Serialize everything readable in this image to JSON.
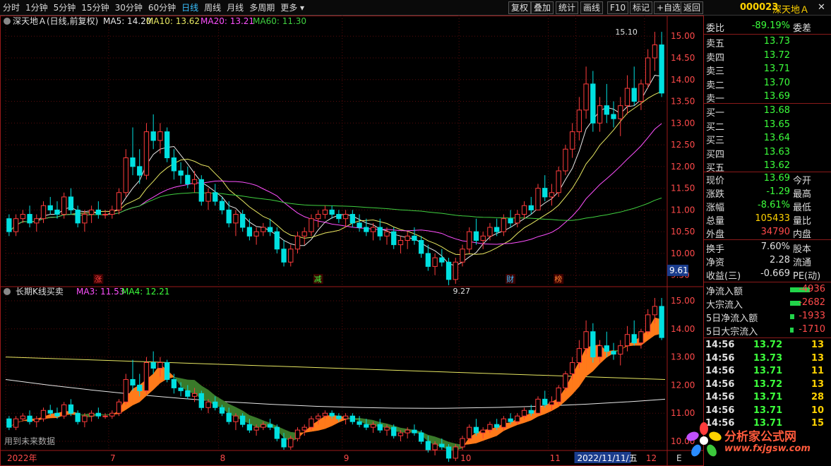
{
  "toolbar": {
    "timeframes": [
      "分时",
      "1分钟",
      "5分钟",
      "15分钟",
      "30分钟",
      "60分钟",
      "日线",
      "周线",
      "月线",
      "多周期",
      "更多"
    ],
    "active_timeframe": "日线",
    "right_buttons": [
      "复权",
      "叠加",
      "统计",
      "画线",
      "F10",
      "标记",
      "+自选",
      "返回"
    ],
    "stock_code": "000023",
    "stock_name": "深天地Ａ",
    "close_icon": "close-icon"
  },
  "main_chart": {
    "title": "深天地Ａ(日线,前复权)",
    "ma_labels": [
      {
        "text": "MA5: 14.20",
        "color": "#e8e8e8"
      },
      {
        "text": "MA10: 13.62",
        "color": "#e8e862"
      },
      {
        "text": "MA20: 13.21",
        "color": "#ff50ff"
      },
      {
        "text": "MA60: 11.30",
        "color": "#40d040"
      }
    ],
    "y_ticks": [
      "15.00",
      "14.50",
      "14.00",
      "13.50",
      "13.00",
      "12.50",
      "12.00",
      "11.50",
      "11.00",
      "10.50",
      "10.00",
      "9.50"
    ],
    "y_max": 15.15,
    "y_min": 9.3,
    "current_price_tag": "9.61",
    "high_marker": "15.10",
    "low_marker": "9.27",
    "event_markers": [
      {
        "text": "涨",
        "color": "#ff4040"
      },
      {
        "text": "减",
        "color": "#3cff3c"
      },
      {
        "text": "财",
        "color": "#39c0ff"
      },
      {
        "text": "榜",
        "color": "#ff8030"
      }
    ]
  },
  "sub_chart": {
    "title": "长期K线买卖",
    "ma_labels": [
      {
        "text": "MA3: 11.53",
        "color": "#ff50ff"
      },
      {
        "text": "MA4: 12.21",
        "color": "#3cff3c"
      }
    ],
    "y_ticks": [
      "15.00",
      "14.00",
      "13.00",
      "12.00",
      "11.00",
      "10.00"
    ],
    "y_max": 15.3,
    "y_min": 9.7,
    "footer_note": "用到未来数据"
  },
  "x_axis": {
    "labels": [
      "2022年",
      "7",
      "8",
      "9",
      "10",
      "11",
      "2022/11/11/五",
      "12"
    ],
    "right_label": "E"
  },
  "chart_data": {
    "type": "candlestick",
    "dates_approx": "2022-05 to 2022-12",
    "ohlc": [
      [
        10.8,
        10.9,
        10.4,
        10.5
      ],
      [
        10.5,
        10.9,
        10.4,
        10.8
      ],
      [
        10.8,
        11.0,
        10.7,
        10.9
      ],
      [
        10.9,
        11.1,
        10.6,
        10.7
      ],
      [
        10.7,
        10.9,
        10.5,
        10.8
      ],
      [
        10.8,
        11.2,
        10.7,
        11.1
      ],
      [
        11.1,
        11.3,
        10.9,
        11.0
      ],
      [
        11.0,
        11.2,
        10.8,
        10.9
      ],
      [
        10.9,
        11.4,
        10.8,
        11.3
      ],
      [
        11.3,
        11.5,
        10.9,
        11.0
      ],
      [
        11.0,
        11.1,
        10.6,
        10.7
      ],
      [
        10.7,
        11.0,
        10.5,
        10.9
      ],
      [
        10.9,
        11.1,
        10.7,
        11.0
      ],
      [
        11.0,
        11.2,
        10.8,
        10.9
      ],
      [
        10.9,
        11.0,
        10.8,
        10.9
      ],
      [
        10.9,
        11.1,
        10.8,
        11.0
      ],
      [
        11.0,
        11.5,
        10.9,
        11.4
      ],
      [
        11.4,
        12.4,
        11.3,
        12.2
      ],
      [
        12.2,
        12.9,
        11.8,
        12.0
      ],
      [
        12.0,
        12.4,
        11.6,
        11.8
      ],
      [
        11.8,
        13.0,
        11.7,
        12.8
      ],
      [
        12.8,
        13.2,
        12.4,
        12.6
      ],
      [
        12.6,
        13.0,
        12.3,
        12.8
      ],
      [
        12.8,
        12.9,
        12.1,
        12.2
      ],
      [
        12.2,
        12.4,
        11.7,
        11.9
      ],
      [
        11.9,
        12.1,
        11.6,
        11.8
      ],
      [
        11.8,
        12.0,
        11.5,
        11.6
      ],
      [
        11.6,
        11.9,
        11.4,
        11.7
      ],
      [
        11.7,
        11.8,
        11.1,
        11.2
      ],
      [
        11.2,
        11.5,
        11.0,
        11.4
      ],
      [
        11.4,
        11.6,
        11.1,
        11.2
      ],
      [
        11.2,
        11.3,
        10.9,
        11.0
      ],
      [
        11.0,
        11.2,
        10.6,
        10.7
      ],
      [
        10.7,
        11.0,
        10.4,
        10.9
      ],
      [
        10.9,
        11.0,
        10.5,
        10.6
      ],
      [
        10.6,
        10.8,
        10.3,
        10.4
      ],
      [
        10.4,
        10.6,
        10.2,
        10.5
      ],
      [
        10.5,
        10.7,
        10.4,
        10.6
      ],
      [
        10.6,
        10.8,
        10.4,
        10.5
      ],
      [
        10.5,
        10.6,
        10.0,
        10.1
      ],
      [
        10.1,
        10.3,
        9.7,
        9.8
      ],
      [
        9.8,
        10.2,
        9.7,
        10.1
      ],
      [
        10.1,
        10.5,
        10.0,
        10.4
      ],
      [
        10.4,
        10.6,
        10.2,
        10.5
      ],
      [
        10.5,
        10.9,
        10.4,
        10.8
      ],
      [
        10.8,
        11.0,
        10.6,
        10.9
      ],
      [
        10.9,
        11.1,
        10.8,
        11.0
      ],
      [
        11.0,
        11.1,
        10.8,
        10.9
      ],
      [
        10.9,
        11.0,
        10.7,
        10.8
      ],
      [
        10.8,
        11.0,
        10.6,
        10.9
      ],
      [
        10.9,
        11.0,
        10.6,
        10.7
      ],
      [
        10.7,
        10.9,
        10.5,
        10.6
      ],
      [
        10.6,
        10.8,
        10.4,
        10.5
      ],
      [
        10.5,
        10.7,
        10.3,
        10.6
      ],
      [
        10.6,
        10.8,
        10.3,
        10.4
      ],
      [
        10.4,
        10.6,
        10.2,
        10.5
      ],
      [
        10.5,
        10.6,
        10.1,
        10.2
      ],
      [
        10.2,
        10.4,
        10.0,
        10.3
      ],
      [
        10.3,
        10.5,
        10.1,
        10.4
      ],
      [
        10.4,
        10.6,
        10.2,
        10.3
      ],
      [
        10.3,
        10.4,
        9.9,
        10.0
      ],
      [
        10.0,
        10.2,
        9.6,
        9.7
      ],
      [
        9.7,
        10.0,
        9.5,
        9.9
      ],
      [
        9.9,
        10.1,
        9.7,
        9.8
      ],
      [
        9.8,
        9.9,
        9.27,
        9.4
      ],
      [
        9.4,
        9.9,
        9.3,
        9.8
      ],
      [
        9.8,
        10.2,
        9.7,
        10.1
      ],
      [
        10.1,
        10.6,
        10.0,
        10.5
      ],
      [
        10.5,
        10.8,
        10.2,
        10.3
      ],
      [
        10.3,
        10.5,
        10.1,
        10.4
      ],
      [
        10.4,
        10.7,
        10.3,
        10.6
      ],
      [
        10.6,
        10.8,
        10.4,
        10.5
      ],
      [
        10.5,
        10.9,
        10.4,
        10.8
      ],
      [
        10.8,
        11.0,
        10.6,
        10.7
      ],
      [
        10.7,
        11.0,
        10.6,
        10.9
      ],
      [
        10.9,
        11.2,
        10.8,
        11.1
      ],
      [
        11.1,
        11.3,
        10.9,
        11.0
      ],
      [
        11.0,
        11.6,
        11.0,
        11.5
      ],
      [
        11.5,
        11.8,
        11.2,
        11.3
      ],
      [
        11.3,
        11.6,
        11.1,
        11.4
      ],
      [
        11.4,
        12.0,
        11.3,
        11.9
      ],
      [
        11.9,
        12.5,
        11.8,
        12.4
      ],
      [
        12.4,
        13.0,
        12.2,
        12.8
      ],
      [
        12.8,
        13.6,
        12.6,
        13.3
      ],
      [
        13.3,
        14.3,
        13.1,
        13.9
      ],
      [
        13.9,
        14.2,
        12.8,
        13.0
      ],
      [
        13.0,
        13.6,
        12.8,
        13.4
      ],
      [
        13.4,
        13.9,
        13.0,
        13.2
      ],
      [
        13.2,
        13.5,
        12.9,
        13.1
      ],
      [
        13.1,
        13.6,
        12.7,
        13.4
      ],
      [
        13.4,
        14.1,
        13.2,
        13.8
      ],
      [
        13.8,
        14.3,
        13.4,
        13.5
      ],
      [
        13.5,
        14.0,
        13.3,
        13.9
      ],
      [
        13.9,
        14.7,
        13.8,
        14.5
      ],
      [
        14.5,
        15.1,
        14.2,
        14.8
      ],
      [
        14.8,
        15.1,
        13.6,
        13.69
      ]
    ],
    "indicators": {
      "MA5": 14.2,
      "MA10": 13.62,
      "MA20": 13.21,
      "MA60": 11.3,
      "MA3": 11.53,
      "MA4": 12.21
    }
  },
  "right_panel": {
    "weibi": {
      "label": "委比",
      "value": "-89.19%",
      "label2": "委差"
    },
    "asks": [
      {
        "label": "卖五",
        "price": "13.73"
      },
      {
        "label": "卖四",
        "price": "13.72"
      },
      {
        "label": "卖三",
        "price": "13.71"
      },
      {
        "label": "卖二",
        "price": "13.70"
      },
      {
        "label": "卖一",
        "price": "13.69"
      }
    ],
    "bids": [
      {
        "label": "买一",
        "price": "13.68"
      },
      {
        "label": "买二",
        "price": "13.65"
      },
      {
        "label": "买三",
        "price": "13.64"
      },
      {
        "label": "买四",
        "price": "13.63"
      },
      {
        "label": "买五",
        "price": "13.62"
      }
    ],
    "quote": [
      {
        "label": "现价",
        "value": "13.69",
        "color": "green",
        "label2": "今开"
      },
      {
        "label": "涨跌",
        "value": "-1.29",
        "color": "green",
        "label2": "最高"
      },
      {
        "label": "涨幅",
        "value": "-8.61%",
        "color": "green",
        "label2": "最低"
      },
      {
        "label": "总量",
        "value": "105433",
        "color": "yellow",
        "label2": "量比"
      },
      {
        "label": "外盘",
        "value": "34790",
        "color": "red",
        "label2": "内盘"
      }
    ],
    "stats": [
      {
        "label": "换手",
        "value": "7.60%",
        "color": "white",
        "label2": "股本"
      },
      {
        "label": "净资",
        "value": "2.28",
        "color": "white",
        "label2": "流通"
      },
      {
        "label": "收益(三)",
        "value": "-0.669",
        "color": "white",
        "label2": "PE(动)"
      }
    ],
    "flows": [
      {
        "label": "净流入额",
        "value": "-4936",
        "bar": 1.0
      },
      {
        "label": "大宗流入",
        "value": "-2682",
        "bar": 0.55
      },
      {
        "label": "5日净流入额",
        "value": "-1933",
        "bar": 0.2
      },
      {
        "label": "5日大宗流入",
        "value": "-1710",
        "bar": 0.18
      }
    ],
    "ticks": [
      {
        "time": "14:56",
        "price": "13.72",
        "vol": "13"
      },
      {
        "time": "14:56",
        "price": "13.73",
        "vol": "13"
      },
      {
        "time": "14:56",
        "price": "13.71",
        "vol": "11"
      },
      {
        "time": "14:56",
        "price": "13.72",
        "vol": "13"
      },
      {
        "time": "14:56",
        "price": "13.71",
        "vol": "28"
      },
      {
        "time": "14:56",
        "price": "13.71",
        "vol": "10"
      },
      {
        "time": "14:56",
        "price": "13.71",
        "vol": "15"
      }
    ]
  },
  "logo": {
    "title": "分析家公式网",
    "url": "www.fxjgsw.com"
  },
  "colors": {
    "up": "#ff3c3c",
    "down": "#00e0e0",
    "grid": "#7a1010",
    "axis": "#9c1a1a",
    "orange_band": "#ff7a1a",
    "green_band": "#3a7a2a"
  }
}
